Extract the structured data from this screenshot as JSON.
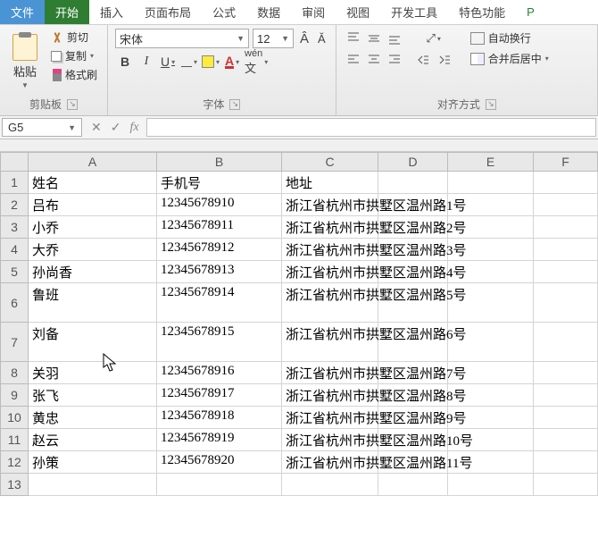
{
  "menu": {
    "file": "文件",
    "home": "开始",
    "insert": "插入",
    "layout": "页面布局",
    "formula": "公式",
    "data": "数据",
    "review": "审阅",
    "view": "视图",
    "dev": "开发工具",
    "special": "特色功能",
    "p": "P"
  },
  "ribbon": {
    "clipboard": {
      "label": "剪贴板",
      "paste": "粘贴",
      "cut": "剪切",
      "copy": "复制",
      "brush": "格式刷"
    },
    "font": {
      "label": "字体",
      "name": "宋体",
      "size": "12"
    },
    "align": {
      "label": "对齐方式",
      "wrap": "自动换行",
      "merge": "合并后居中"
    }
  },
  "namebox": "G5",
  "columns": [
    "A",
    "B",
    "C",
    "D",
    "E",
    "F"
  ],
  "headers": {
    "a": "姓名",
    "b": "手机号",
    "c": "地址"
  },
  "rows": [
    {
      "n": "1",
      "a": "姓名",
      "b": "手机号",
      "c": "地址",
      "h": "h24"
    },
    {
      "n": "2",
      "a": "吕布",
      "b": "12345678910",
      "c": "浙江省杭州市拱墅区温州路1号",
      "h": "h24"
    },
    {
      "n": "3",
      "a": "小乔",
      "b": "12345678911",
      "c": "浙江省杭州市拱墅区温州路2号",
      "h": "h24"
    },
    {
      "n": "4",
      "a": "大乔",
      "b": "12345678912",
      "c": "浙江省杭州市拱墅区温州路3号",
      "h": "h24"
    },
    {
      "n": "5",
      "a": "孙尚香",
      "b": "12345678913",
      "c": "浙江省杭州市拱墅区温州路4号",
      "h": "h24"
    },
    {
      "n": "6",
      "a": "鲁班",
      "b": "12345678914",
      "c": "浙江省杭州市拱墅区温州路5号",
      "h": "h40"
    },
    {
      "n": "7",
      "a": "刘备",
      "b": "12345678915",
      "c": "浙江省杭州市拱墅区温州路6号",
      "h": "h40"
    },
    {
      "n": "8",
      "a": "关羽",
      "b": "12345678916",
      "c": "浙江省杭州市拱墅区温州路7号",
      "h": "h24"
    },
    {
      "n": "9",
      "a": "张飞",
      "b": "12345678917",
      "c": "浙江省杭州市拱墅区温州路8号",
      "h": "h24"
    },
    {
      "n": "10",
      "a": "黄忠",
      "b": "12345678918",
      "c": "浙江省杭州市拱墅区温州路9号",
      "h": "h24"
    },
    {
      "n": "11",
      "a": "赵云",
      "b": "12345678919",
      "c": "浙江省杭州市拱墅区温州路10号",
      "h": "h24"
    },
    {
      "n": "12",
      "a": "孙策",
      "b": "12345678920",
      "c": "浙江省杭州市拱墅区温州路11号",
      "h": "h24"
    },
    {
      "n": "13",
      "a": "",
      "b": "",
      "c": "",
      "h": "h24"
    }
  ]
}
